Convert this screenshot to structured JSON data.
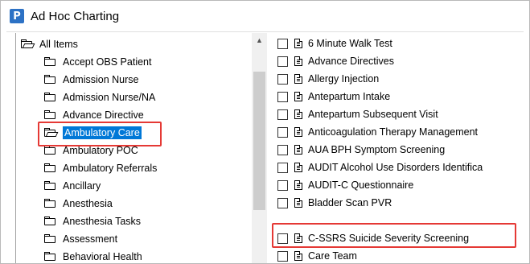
{
  "window": {
    "title": "Ad Hoc Charting",
    "app_icon_letter": "P",
    "highlight_color": "#e53935",
    "selection_color": "#0078d7"
  },
  "tree": {
    "root_label": "All Items",
    "items": [
      {
        "label": "Accept OBS Patient",
        "icon": "folder-icon"
      },
      {
        "label": "Admission Nurse",
        "icon": "folder-icon"
      },
      {
        "label": "Admission Nurse/NA",
        "icon": "folder-icon"
      },
      {
        "label": "Advance Directive",
        "icon": "folder-icon"
      },
      {
        "label": "Ambulatory Care",
        "icon": "folder-open-icon",
        "selected": true
      },
      {
        "label": "Ambulatory POC",
        "icon": "folder-icon"
      },
      {
        "label": "Ambulatory Referrals",
        "icon": "folder-icon"
      },
      {
        "label": "Ancillary",
        "icon": "folder-icon"
      },
      {
        "label": "Anesthesia",
        "icon": "folder-icon"
      },
      {
        "label": "Anesthesia Tasks",
        "icon": "folder-icon"
      },
      {
        "label": "Assessment",
        "icon": "folder-icon"
      },
      {
        "label": "Behavioral Health",
        "icon": "folder-icon"
      }
    ]
  },
  "scrollbar": {
    "up_arrow": "▲"
  },
  "forms": {
    "items": [
      {
        "label": "6 Minute Walk Test",
        "checked": false
      },
      {
        "label": "Advance Directives",
        "checked": false
      },
      {
        "label": "Allergy Injection",
        "checked": false
      },
      {
        "label": "Antepartum Intake",
        "checked": false
      },
      {
        "label": "Antepartum Subsequent Visit",
        "checked": false
      },
      {
        "label": "Anticoagulation Therapy Management",
        "checked": false
      },
      {
        "label": "AUA BPH Symptom Screening",
        "checked": false
      },
      {
        "label": "AUDIT Alcohol Use Disorders Identifica",
        "checked": false
      },
      {
        "label": "AUDIT-C Questionnaire",
        "checked": false
      },
      {
        "label": "Bladder Scan PVR",
        "checked": false
      },
      {
        "label": "C-SSRS Suicide Severity Screening",
        "checked": false,
        "highlighted": true
      },
      {
        "label": "Care Team",
        "checked": false
      }
    ]
  }
}
